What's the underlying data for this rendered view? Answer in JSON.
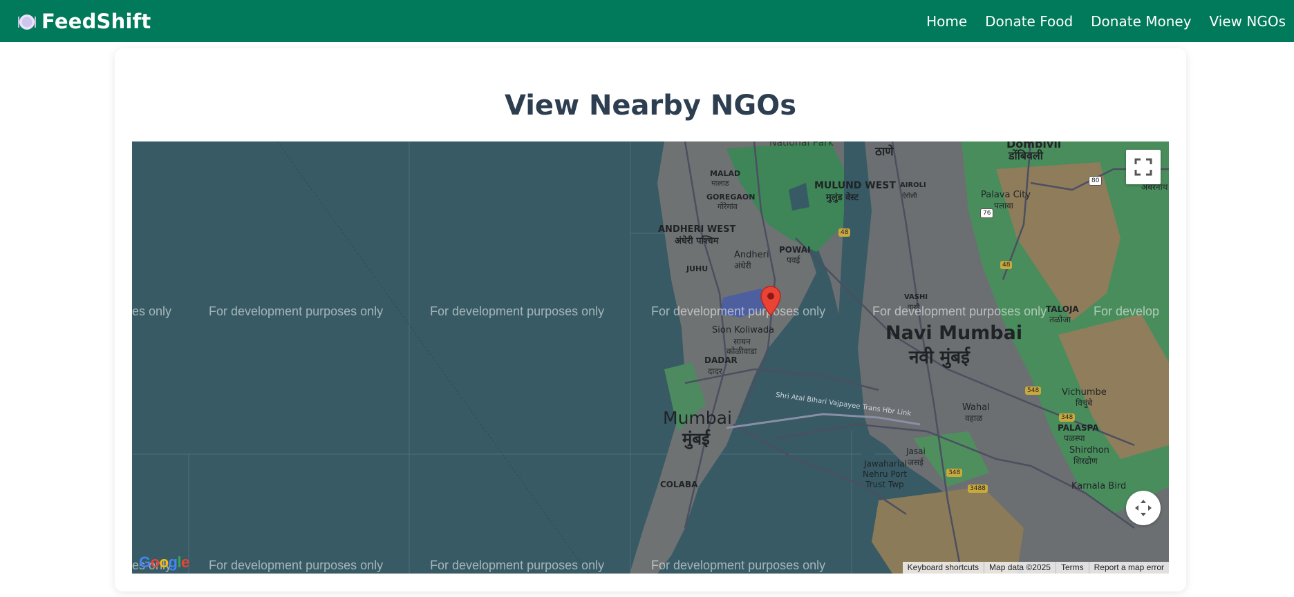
{
  "brand": {
    "name": "FeedShift",
    "icon": "plate-icon"
  },
  "nav": {
    "items": [
      {
        "label": "Home"
      },
      {
        "label": "Donate Food"
      },
      {
        "label": "Donate Money"
      },
      {
        "label": "View NGOs"
      }
    ]
  },
  "page": {
    "title": "View Nearby NGOs"
  },
  "map": {
    "watermark": "For development purposes only",
    "watermark_partial_left": "es only",
    "watermark_partial_right": "For develop",
    "footer": {
      "keyboard": "Keyboard shortcuts",
      "data": "Map data ©2025",
      "terms": "Terms",
      "report": "Report a map error"
    },
    "google_logo": "Google",
    "labels": {
      "national_park": "National Park",
      "thane": "ठाणे",
      "dombivli": "Dombivli",
      "dombivli_hi": "डोंबिवली",
      "malad": "MALAD",
      "malad_hi": "मालाड",
      "goregaon": "GOREGAON",
      "goregaon_hi": "गोरेगांव",
      "mulund": "MULUND WEST",
      "mulund_hi": "मुलुंड वेस्ट",
      "airoli": "AIROLI",
      "airoli_hi": "ऐरोली",
      "palava": "Palava City",
      "palava_hi": "पलावा",
      "ambernath_hi": "अंबरनाथ",
      "andheri_west": "ANDHERI WEST",
      "andheri_west_hi": "अंधेरी पश्चिम",
      "andheri": "Andheri",
      "andheri_hi": "अंधेरी",
      "powai": "POWAI",
      "powai_hi": "पवई",
      "juhu": "JUHU",
      "vashi": "VASHI",
      "vashi_hi": "वाशी",
      "taloja": "TALOJA",
      "taloja_hi": "तळोजा",
      "sion": "Sion Koliwada",
      "sion_hi": "सायन",
      "sion_hi2": "कोळीवाडा",
      "dadar": "DADAR",
      "dadar_hi": "दादर",
      "navi_mumbai": "Navi Mumbai",
      "navi_mumbai_hi": "नवी मुंबई",
      "atal_setu": "Shri Atal Bihari Vajpayee Trans Hbr Link",
      "vichumbe": "Vichumbe",
      "vichumbe_hi": "विचुंबे",
      "wahal": "Wahal",
      "wahal_hi": "वहाळ",
      "palaspa": "PALASPA",
      "palaspa_hi": "पळस्पा",
      "shirdhon": "Shirdhon",
      "shirdhon_hi": "शिरढोण",
      "mumbai": "Mumbai",
      "mumbai_hi": "मुंबई",
      "jasai": "Jasai",
      "jasai_hi": "जसई",
      "jnpt1": "Jawaharlal",
      "jnpt2": "Nehru Port",
      "jnpt3": "Trust Twp",
      "colaba": "COLABA",
      "karnala": "Karnala Bird",
      "road_48a": "48",
      "road_48b": "48",
      "road_80": "80",
      "road_76": "76",
      "road_548": "548",
      "road_348a": "348",
      "road_348b": "348",
      "road_3488": "3488"
    }
  }
}
